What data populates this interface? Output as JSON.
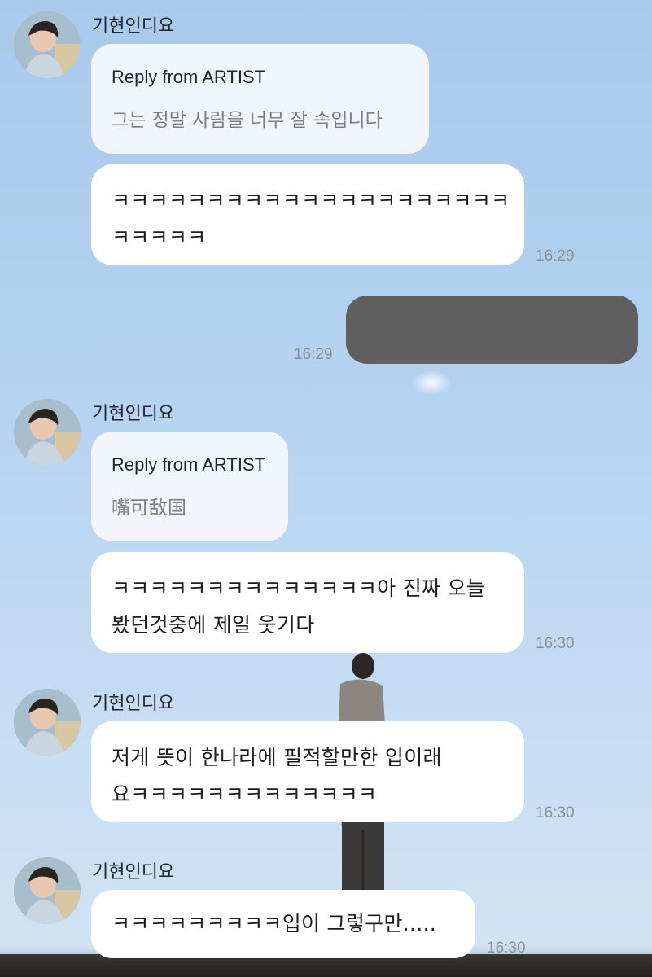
{
  "messages": [
    {
      "sender": "기현인디요",
      "reply_label": "Reply from ARTIST",
      "reply_text": "그는 정말 사람을 너무 잘 속입니다"
    },
    {
      "text_line1": "ㅋㅋㅋㅋㅋㅋㅋㅋㅋㅋㅋㅋㅋㅋㅋㅋㅋㅋㅋㅋㅋ",
      "text_line2": "ㅋㅋㅋㅋㅋ",
      "time": "16:29"
    },
    {
      "own": true,
      "time": "16:29"
    },
    {
      "sender": "기현인디요",
      "reply_label": "Reply from ARTIST",
      "reply_text": "嘴可敌国"
    },
    {
      "text_line1": "ㅋㅋㅋㅋㅋㅋㅋㅋㅋㅋㅋㅋㅋㅋ아 진짜 오늘",
      "text_line2": "봤던것중에 제일 웃기다",
      "time": "16:30"
    },
    {
      "sender": "기현인디요",
      "text_line1": "저게 뜻이 한나라에 필적할만한 입이래",
      "text_line2": "요ㅋㅋㅋㅋㅋㅋㅋㅋㅋㅋㅋㅋㅋ",
      "time": "16:30"
    },
    {
      "sender": "기현인디요",
      "text_line1": "ㅋㅋㅋㅋㅋㅋㅋㅋㅋ입이 그렇구만.....",
      "time": "16:30"
    }
  ],
  "icons": {
    "avatar": "profile-photo",
    "background": "sky-photo-wallpaper"
  },
  "colors": {
    "bubble": "#ffffff",
    "own_bubble_redacted": "#5f5f5f",
    "time": "#8a9099",
    "reply_text": "#7d7f86"
  }
}
